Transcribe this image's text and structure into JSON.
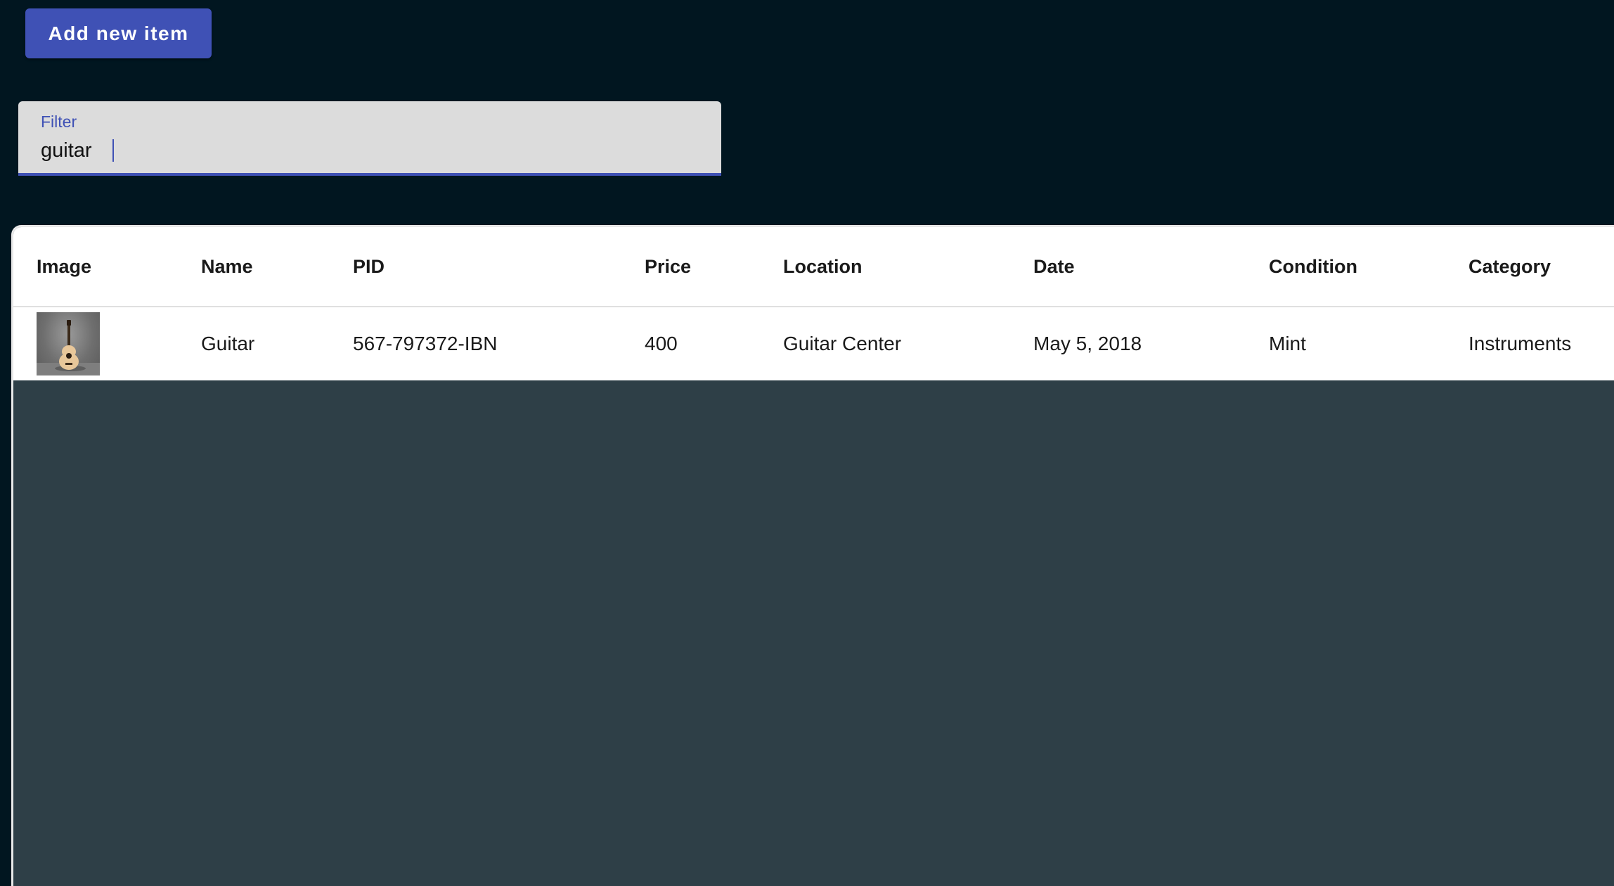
{
  "toolbar": {
    "add_label": "Add new item"
  },
  "filter": {
    "label": "Filter",
    "value": "guitar"
  },
  "table": {
    "headers": [
      "Image",
      "Name",
      "PID",
      "Price",
      "Location",
      "Date",
      "Condition",
      "Category"
    ],
    "rows": [
      {
        "image": "guitar-image",
        "name": "Guitar",
        "pid": "567-797372-IBN",
        "price": "400",
        "location": "Guitar Center",
        "date": "May 5, 2018",
        "condition": "Mint",
        "category": "Instruments"
      }
    ]
  },
  "colors": {
    "background": "#011620",
    "accent": "#3f51b5",
    "table_empty": "#2e3f47",
    "filter_bg": "#dcdcdc"
  }
}
